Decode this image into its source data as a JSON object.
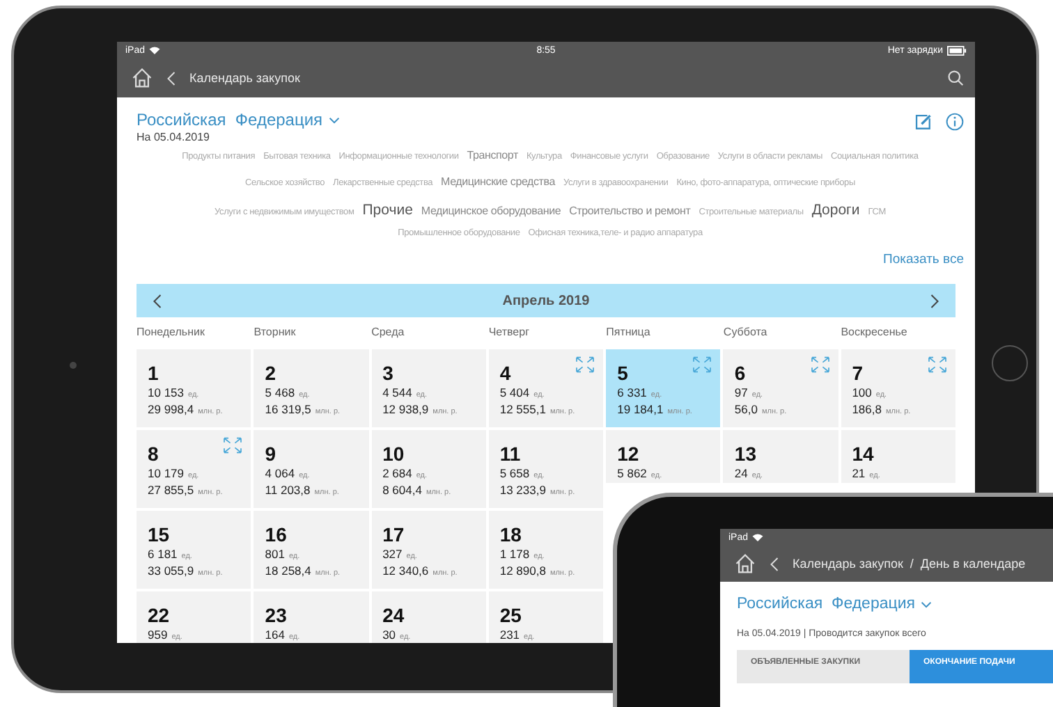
{
  "status_bar": {
    "carrier": "iPad",
    "time": "8:55",
    "battery_text": "Нет зарядки"
  },
  "nav": {
    "title": "Календарь закупок"
  },
  "region": {
    "title": "Российская  Федерация",
    "date": "На 05.04.2019"
  },
  "tag_rows": [
    [
      {
        "label": "Продукты питания",
        "kind": "small"
      },
      {
        "label": "Бытовая техника",
        "kind": "small"
      },
      {
        "label": "Информационные технологии",
        "kind": "small"
      },
      {
        "label": "Транспорт",
        "kind": "medium"
      },
      {
        "label": "Культура",
        "kind": "small"
      },
      {
        "label": "Финансовые услуги",
        "kind": "small"
      },
      {
        "label": "Образование",
        "kind": "small"
      },
      {
        "label": "Услуги в области рекламы",
        "kind": "small"
      },
      {
        "label": "Социальная политика",
        "kind": "small"
      }
    ],
    [
      {
        "label": "Сельское хозяйство",
        "kind": "small"
      },
      {
        "label": "Лекарственные средства",
        "kind": "small"
      },
      {
        "label": "Медицинские средства",
        "kind": "medium"
      },
      {
        "label": "Услуги в здравоохранении",
        "kind": "small"
      },
      {
        "label": "Кино, фото-аппаратура, оптические приборы",
        "kind": "small"
      }
    ],
    [
      {
        "label": "Услуги с недвижимым имуществом",
        "kind": "small"
      },
      {
        "label": "Прочие",
        "kind": "large"
      },
      {
        "label": "Медицинское оборудование",
        "kind": "medium"
      },
      {
        "label": "Строительство и ремонт",
        "kind": "medium"
      },
      {
        "label": "Строительные материалы",
        "kind": "small"
      },
      {
        "label": "Дороги",
        "kind": "large"
      },
      {
        "label": "ГСМ",
        "kind": "small"
      }
    ],
    [
      {
        "label": "Промышленное оборудование",
        "kind": "small"
      },
      {
        "label": "Офисная техника,теле- и радио аппаратура",
        "kind": "small"
      }
    ]
  ],
  "show_all": "Показать все",
  "calendar": {
    "month": "Апрель 2019",
    "weekdays": [
      "Понедельник",
      "Вторник",
      "Среда",
      "Четверг",
      "Пятница",
      "Суббота",
      "Воскресенье"
    ],
    "weeks": [
      [
        {
          "kind": "full",
          "day": "1",
          "count": "10 153",
          "count_unit": "ед.",
          "amount": "29 998,4",
          "amount_unit": "млн. р.",
          "selected": false,
          "expandable": false
        },
        {
          "kind": "full",
          "day": "2",
          "count": "5 468",
          "count_unit": "ед.",
          "amount": "16 319,5",
          "amount_unit": "млн. р.",
          "selected": false,
          "expandable": false
        },
        {
          "kind": "full",
          "day": "3",
          "count": "4 544",
          "count_unit": "ед.",
          "amount": "12 938,9",
          "amount_unit": "млн. р.",
          "selected": false,
          "expandable": false
        },
        {
          "kind": "full",
          "day": "4",
          "count": "5 404",
          "count_unit": "ед.",
          "amount": "12 555,1",
          "amount_unit": "млн. р.",
          "selected": false,
          "expandable": true
        },
        {
          "kind": "full",
          "day": "5",
          "count": "6 331",
          "count_unit": "ед.",
          "amount": "19 184,1",
          "amount_unit": "млн. р.",
          "selected": true,
          "expandable": true
        },
        {
          "kind": "full",
          "day": "6",
          "count": "97",
          "count_unit": "ед.",
          "amount": "56,0",
          "amount_unit": "млн. р.",
          "selected": false,
          "expandable": true
        },
        {
          "kind": "full",
          "day": "7",
          "count": "100",
          "count_unit": "ед.",
          "amount": "186,8",
          "amount_unit": "млн. р.",
          "selected": false,
          "expandable": true
        }
      ],
      [
        {
          "kind": "full",
          "day": "8",
          "count": "10 179",
          "count_unit": "ед.",
          "amount": "27 855,5",
          "amount_unit": "млн. р.",
          "selected": false,
          "expandable": true
        },
        {
          "kind": "full",
          "day": "9",
          "count": "4 064",
          "count_unit": "ед.",
          "amount": "11 203,8",
          "amount_unit": "млн. р.",
          "selected": false,
          "expandable": false
        },
        {
          "kind": "full",
          "day": "10",
          "count": "2 684",
          "count_unit": "ед.",
          "amount": "8 604,4",
          "amount_unit": "млн. р.",
          "selected": false,
          "expandable": false
        },
        {
          "kind": "full",
          "day": "11",
          "count": "5 658",
          "count_unit": "ед.",
          "amount": "13 233,9",
          "amount_unit": "млн. р.",
          "selected": false,
          "expandable": false
        },
        {
          "kind": "partial",
          "day": "12",
          "count": "5 862",
          "count_unit": "ед.",
          "selected": false,
          "expandable": false
        },
        {
          "kind": "partial",
          "day": "13",
          "count": "24",
          "count_unit": "ед.",
          "selected": false,
          "expandable": false
        },
        {
          "kind": "partial",
          "day": "14",
          "count": "21",
          "count_unit": "ед.",
          "selected": false,
          "expandable": false
        }
      ],
      [
        {
          "kind": "full",
          "day": "15",
          "count": "6 181",
          "count_unit": "ед.",
          "amount": "33 055,9",
          "amount_unit": "млн. р.",
          "selected": false,
          "expandable": false
        },
        {
          "kind": "full",
          "day": "16",
          "count": "801",
          "count_unit": "ед.",
          "amount": "18 258,4",
          "amount_unit": "млн. р.",
          "selected": false,
          "expandable": false
        },
        {
          "kind": "full",
          "day": "17",
          "count": "327",
          "count_unit": "ед.",
          "amount": "12 340,6",
          "amount_unit": "млн. р.",
          "selected": false,
          "expandable": false
        },
        {
          "kind": "full",
          "day": "18",
          "count": "1 178",
          "count_unit": "ед.",
          "amount": "12 890,8",
          "amount_unit": "млн. р.",
          "selected": false,
          "expandable": false
        },
        {
          "kind": "covered"
        },
        {
          "kind": "covered"
        },
        {
          "kind": "covered"
        }
      ],
      [
        {
          "kind": "full",
          "day": "22",
          "count": "959",
          "count_unit": "ед.",
          "selected": false,
          "expandable": false
        },
        {
          "kind": "full",
          "day": "23",
          "count": "164",
          "count_unit": "ед.",
          "selected": false,
          "expandable": false
        },
        {
          "kind": "full",
          "day": "24",
          "count": "30",
          "count_unit": "ед.",
          "selected": false,
          "expandable": false
        },
        {
          "kind": "full",
          "day": "25",
          "count": "231",
          "count_unit": "ед.",
          "selected": false,
          "expandable": false
        },
        {
          "kind": "covered"
        },
        {
          "kind": "covered"
        },
        {
          "kind": "covered"
        }
      ]
    ]
  },
  "second_screen": {
    "status_bar": {
      "carrier": "iPad"
    },
    "breadcrumb": "Календарь закупок  /  День в календаре",
    "region_title": "Российская  Федерация",
    "info": "На 05.04.2019 | Проводится закупок всего",
    "tabs": [
      {
        "label": "ОБЪЯВЛЕННЫЕ ЗАКУПКИ",
        "selected": false
      },
      {
        "label": "ОКОНЧАНИЕ ПОДАЧИ",
        "selected": true
      }
    ]
  }
}
